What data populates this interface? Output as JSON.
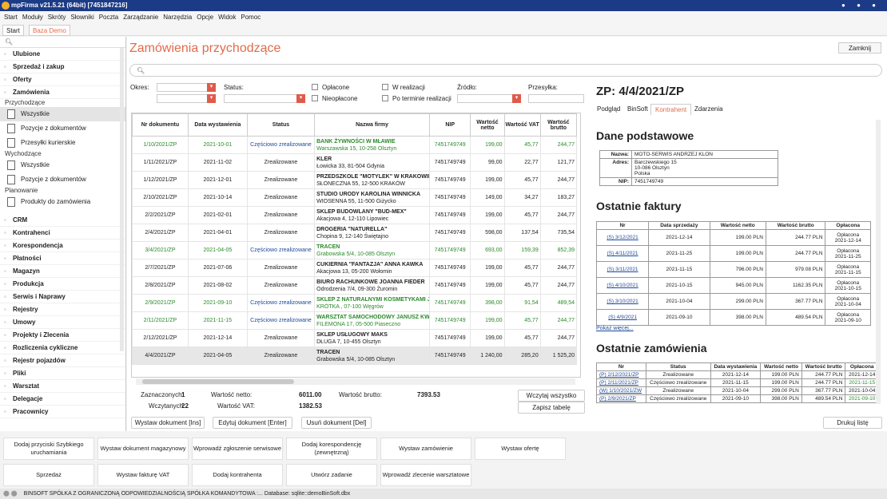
{
  "app": {
    "title": "mpFirma v21.5.21 (64bit) [7451847216]"
  },
  "menu": [
    "Start",
    "Moduły",
    "Skróty",
    "Słowniki",
    "Poczta",
    "Zarządzanie",
    "Narzędzia",
    "Opcje",
    "Widok",
    "Pomoc"
  ],
  "tabs": [
    "Start",
    "Baza Demo"
  ],
  "sidebar": {
    "groups_top": [
      "Ulubione",
      "Sprzedaż i zakup",
      "Oferty",
      "Zamówienia"
    ],
    "sub_przychodzace": "Przychodzące",
    "items_przy": [
      "Wszystkie",
      "Pozycje z dokumentów",
      "Przesyłki kurierskie"
    ],
    "sub_wychodzace": "Wychodzące",
    "items_wych": [
      "Wszystkie",
      "Pozycje z dokumentów"
    ],
    "sub_planowanie": "Planowanie",
    "items_plan": [
      "Produkty do zamówienia"
    ],
    "groups_bottom": [
      "CRM",
      "Kontrahenci",
      "Korespondencja",
      "Płatności",
      "Magazyn",
      "Produkcja",
      "Serwis i Naprawy",
      "Rejestry",
      "Umowy",
      "Projekty i Zlecenia",
      "Rozliczenia cykliczne",
      "Rejestr pojazdów",
      "Pliki",
      "Warsztat",
      "Delegacje",
      "Pracownicy"
    ]
  },
  "page": {
    "title": "Zamówienia przychodzące",
    "close": "Zamknij"
  },
  "filters": {
    "okres": "Okres:",
    "status": "Status:",
    "oplacone": "Opłacone",
    "nieoplacone": "Nieopłacone",
    "w_realizacji": "W realizacji",
    "po_terminie": "Po terminie realizacji",
    "zrodlo": "Źródło:",
    "przesylka": "Przesyłka:"
  },
  "grid": {
    "headers": [
      "Nr dokumentu",
      "Data wystawienia",
      "Status",
      "Nazwa firmy",
      "NIP",
      "Wartość netto",
      "Wartość VAT",
      "Wartość brutto"
    ],
    "rows": [
      [
        "1/10/2021/ZP",
        "2021-10-01",
        "Częściowo zrealizowane",
        "BANK ŻYWNOŚCI W MŁAWIE",
        "Warszawska 15, 10-258 Olsztyn",
        "7451749749",
        "199,00",
        "45,77",
        "244,77",
        "green"
      ],
      [
        "1/11/2021/ZP",
        "2021-11-02",
        "Zrealizowane",
        "KLER",
        "Łowicka 33, 81-504 Gdynia",
        "7451749749",
        "99,00",
        "22,77",
        "121,77",
        ""
      ],
      [
        "1/12/2021/ZP",
        "2021-12-01",
        "Zrealizowane",
        "PRZEDSZKOLE \"MOTYLEK\" W KRAKOWIE",
        "SŁONECZNA 55, 12-500 KRAKÓW",
        "7451749749",
        "199,00",
        "45,77",
        "244,77",
        ""
      ],
      [
        "2/10/2021/ZP",
        "2021-10-14",
        "Zrealizowane",
        "STUDIO URODY KAROLINA WINNICKA",
        "WIOSENNA 55, 11-500 Giżycko",
        "7451749749",
        "149,00",
        "34,27",
        "183,27",
        ""
      ],
      [
        "2/2/2021/ZP",
        "2021-02-01",
        "Zrealizowane",
        "SKLEP BUDOWLANY \"BUD-MEX\"",
        "Akacjowa 4, 12-110 Lipowiec",
        "7451749749",
        "199,00",
        "45,77",
        "244,77",
        ""
      ],
      [
        "2/4/2021/ZP",
        "2021-04-01",
        "Zrealizowane",
        "DROGERIA \"NATURELLA\"",
        "Chopina 9, 12-140 Świętajno",
        "7451749749",
        "598,00",
        "137,54",
        "735,54",
        ""
      ],
      [
        "3/4/2021/ZP",
        "2021-04-05",
        "Częściowo zrealizowane",
        "TRACEN",
        "Grabowska 5/4, 10-085 Olsztyn",
        "7451749749",
        "693,00",
        "159,39",
        "852,39",
        "green"
      ],
      [
        "2/7/2021/ZP",
        "2021-07-06",
        "Zrealizowane",
        "CUKIERNIA \"FANTAZJA\" ANNA KAWKA",
        "Akacjowa 13, 05-200 Wołomin",
        "7451749749",
        "199,00",
        "45,77",
        "244,77",
        ""
      ],
      [
        "2/8/2021/ZP",
        "2021-08-02",
        "Zrealizowane",
        "BIURO RACHUNKOWE JOANNA FIEDER",
        "Odrodzenia 7/4, 09-300 Żuromin",
        "7451749749",
        "199,00",
        "45,77",
        "244,77",
        ""
      ],
      [
        "2/9/2021/ZP",
        "2021-09-10",
        "Częściowo zrealizowane",
        "SKLEP Z NATURALNYMI KOSMETYKAMI JAI",
        "KRÓTKA , 07-100 Węgrów",
        "7451749749",
        "398,00",
        "91,54",
        "489,54",
        "green"
      ],
      [
        "2/11/2021/ZP",
        "2021-11-15",
        "Częściowo zrealizowane",
        "WARSZTAT SAMOCHODOWY JANUSZ KWA",
        "FILEMONA 17, 05-500 Piaseczno",
        "7451749749",
        "199,00",
        "45,77",
        "244,77",
        "green"
      ],
      [
        "2/12/2021/ZP",
        "2021-12-14",
        "Zrealizowane",
        "SKLEP USŁUGOWY MAKS",
        "DŁUGA 7, 10-455 Olsztyn",
        "7451749749",
        "199,00",
        "45,77",
        "244,77",
        ""
      ],
      [
        "4/4/2021/ZP",
        "2021-04-05",
        "Zrealizowane",
        "TRACEN",
        "Grabowska 5/4, 10-085 Olsztyn",
        "7451749749",
        "1 240,00",
        "285,20",
        "1 525,20",
        "sel"
      ]
    ]
  },
  "totals": {
    "zazn_label": "Zaznaczonych:",
    "zazn": "1",
    "wczyt_label": "Wczytanych:",
    "wczyt": "22",
    "netto_label": "Wartość netto:",
    "netto": "6011.00",
    "vat_label": "Wartość VAT:",
    "vat": "1382.53",
    "brutto_label": "Wartość brutto:",
    "brutto": "7393.53",
    "load_all": "Wczytaj wszystko",
    "save_table": "Zapisz tabelę"
  },
  "actions": {
    "add": "Wystaw dokument [Ins]",
    "edit": "Edytuj dokument [Enter]",
    "del": "Usuń dokument [Del]",
    "print": "Drukuj listę"
  },
  "detail": {
    "title": "ZP: 4/4/2021/ZP",
    "tabs": [
      "Podgląd",
      "BinSoft",
      "Kontrahent",
      "Zdarzenia"
    ],
    "dane": "Dane podstawowe",
    "nazwa_l": "Nazwa:",
    "nazwa": "MOTO-SERWIS ANDRZEJ KLON",
    "adres_l": "Adres:",
    "adres1": "Barczewskiego 15",
    "adres2": "10-086 Olsztyn",
    "adres3": "Polska",
    "nip_l": "NIP:",
    "nip": "7451749749",
    "faktury": "Ostatnie faktury",
    "f_headers": [
      "Nr",
      "Data sprzedaży",
      "Wartość netto",
      "Wartość brutto",
      "Opłacona"
    ],
    "f_rows": [
      [
        "(S) 3/12/2021",
        "2021-12-14",
        "199.00 PLN",
        "244.77 PLN",
        "Opłacona",
        "2021-12-14"
      ],
      [
        "(S) 4/11/2021",
        "2021-11-25",
        "199.00 PLN",
        "244.77 PLN",
        "Opłacona",
        "2021-11-25"
      ],
      [
        "(S) 3/11/2021",
        "2021-11-15",
        "796.00 PLN",
        "979.08 PLN",
        "Opłacona",
        "2021-11-15"
      ],
      [
        "(S) 4/10/2021",
        "2021-10-15",
        "945.00 PLN",
        "1162.35 PLN",
        "Opłacona",
        "2021-10-15"
      ],
      [
        "(S) 3/10/2021",
        "2021-10-04",
        "299.00 PLN",
        "367.77 PLN",
        "Opłacona",
        "2021-10-04"
      ],
      [
        "(S) 4/9/2021",
        "2021-09-10",
        "398.00 PLN",
        "489.54 PLN",
        "Opłacona",
        "2021-09-10"
      ]
    ],
    "more": "Pokaż więcej...",
    "zamowienia": "Ostatnie zamówienia",
    "z_headers": [
      "Nr",
      "Status",
      "Data wystawienia",
      "Wartość netto",
      "Wartość brutto",
      "Opłacona"
    ],
    "z_rows": [
      [
        "(P) 2/12/2021/ZP",
        "Zrealizowane",
        "2021-12-14",
        "199.00 PLN",
        "244.77 PLN",
        "2021-12-14"
      ],
      [
        "(P) 2/11/2021/ZP",
        "Częściowo zrealizowane",
        "2021-11-15",
        "199.00 PLN",
        "244.77 PLN",
        "2021-11-15"
      ],
      [
        "(W) 1/10/2021/ZW",
        "Zrealizowane",
        "2021-10-04",
        "299.00 PLN",
        "367.77 PLN",
        "2021-10-04"
      ],
      [
        "(P) 2/9/2021/ZP",
        "Częściowo zrealizowane",
        "2021-09-10",
        "398.00 PLN",
        "489.54 PLN",
        "2021-09-10"
      ]
    ]
  },
  "bottom": {
    "row1": [
      "Dodaj przyciski Szybkiego uruchamiania",
      "Wystaw dokument magazynowy",
      "Wprowadź zgłoszenie serwisowe",
      "Dodaj korespondencję (zewnętrzną)",
      "Wystaw zamówienie",
      "Wystaw ofertę"
    ],
    "row2": [
      "Sprzedaż",
      "Wystaw fakturę VAT",
      "Dodaj kontrahenta",
      "Utwórz zadanie",
      "Wprowadź zlecenie warsztatowe"
    ]
  },
  "status": "BINSOFT SPÓŁKA Z OGRANICZONĄ ODPOWIEDZIALNOŚCIĄ SPÓŁKA KOMANDYTOWA :... Database: sqlite::demoBinSoft.dbx",
  "colors": {
    "accent": "#e26b4a",
    "title_bar": "#1c3b86",
    "green": "#2a8a2a",
    "link": "#1d4a9a"
  }
}
